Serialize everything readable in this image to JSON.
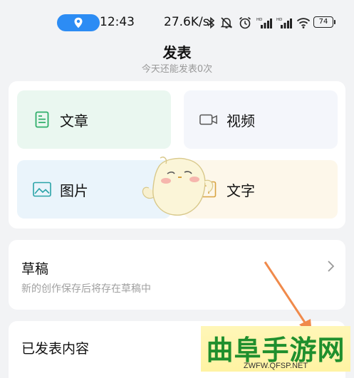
{
  "status_bar": {
    "time": "12:43",
    "net_speed": "27.6K/s",
    "battery": "74",
    "icons": [
      "location-icon",
      "bluetooth-icon",
      "mute-icon",
      "alarm-icon",
      "signal-icon",
      "signal-icon",
      "wifi-icon",
      "battery-icon"
    ]
  },
  "header": {
    "title": "发表",
    "subtitle": "今天还能发表0次"
  },
  "publish_options": [
    {
      "label": "文章",
      "icon": "article-icon",
      "bg": "#eaf7f0",
      "icon_color": "#2fae6a"
    },
    {
      "label": "视频",
      "icon": "video-icon",
      "bg": "#f4f6fb",
      "icon_color": "#555555"
    },
    {
      "label": "图片",
      "icon": "image-icon",
      "bg": "#eaf4fb",
      "icon_color": "#2aa3a8"
    },
    {
      "label": "文字",
      "icon": "text-icon",
      "bg": "#fdf7ea",
      "icon_color": "#d9a441"
    }
  ],
  "drafts": {
    "title": "草稿",
    "description": "新的创作保存后将存在草稿中"
  },
  "published": {
    "title": "已发表内容"
  },
  "watermark": {
    "text": "曲阜手游网",
    "url": "ZWFW.QFSP.NET"
  },
  "colors": {
    "accent_blue": "#2c8cf4",
    "arrow_orange": "#f08a4b",
    "watermark_green": "#1f8f2d"
  }
}
